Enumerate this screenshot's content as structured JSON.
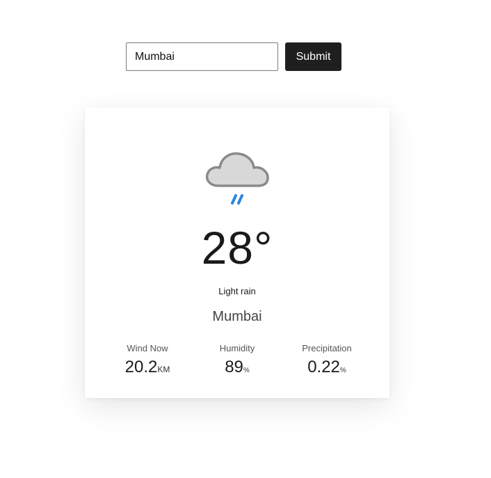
{
  "search": {
    "value": "Mumbai",
    "submit_label": "Submit"
  },
  "weather": {
    "icon": "rain-cloud-icon",
    "temperature": "28°",
    "condition": "Light rain",
    "city": "Mumbai",
    "stats": [
      {
        "label": "Wind Now",
        "value": "20.2",
        "unit": "KM"
      },
      {
        "label": "Humidity",
        "value": "89",
        "unit": "%"
      },
      {
        "label": "Precipitation",
        "value": "0.22",
        "unit": "%"
      }
    ]
  },
  "colors": {
    "button_bg": "#1f1f1f",
    "rain_accent": "#2e86de",
    "cloud_fill": "#d8d8d8",
    "cloud_stroke": "#8a8a8a"
  }
}
